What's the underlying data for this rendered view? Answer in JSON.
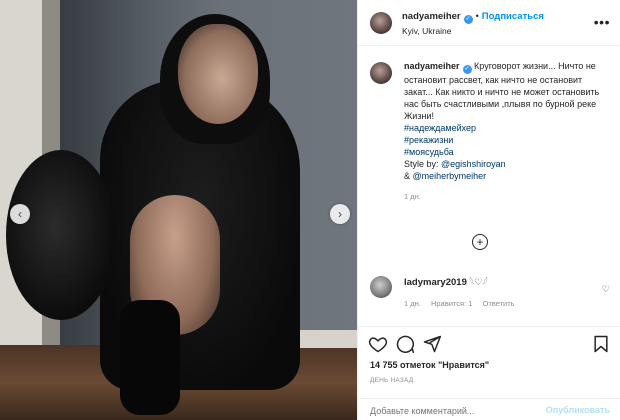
{
  "header": {
    "username": "nadyameiher",
    "separator": "•",
    "follow_label": "Подписаться",
    "location": "Kyiv, Ukraine",
    "more_label": "•••"
  },
  "caption": {
    "username": "nadyameiher",
    "text": "Круговорот жизни... Ничто не остановит рассвет, как ничто не остановит закат... Как никто и ничто не может остановить нас быть счастливыми ,плывя по бурной реке Жизни!",
    "hashtags": [
      "#надеждамейхер",
      "#рекажизни",
      "#моясудьба"
    ],
    "style_prefix": "Style by: ",
    "mention1": "@egishshiroyan",
    "amp": "& ",
    "mention2": "@meiherbymeiher",
    "time": "1 дн."
  },
  "add_comment_icon": "plus-circle-icon",
  "comment": {
    "username": "ladymary2019",
    "text": "𓆩♡𓆪",
    "time": "1 дн.",
    "likes": "Нравится: 1",
    "reply": "Ответить"
  },
  "likes_text": "14 755 отметок \"Нравится\"",
  "date_text": "ДЕНЬ НАЗАД",
  "input": {
    "placeholder": "Добавьте комментарий..."
  },
  "publish_label": "Опубликовать",
  "colors": {
    "link": "#00376b",
    "accent": "#0095f6",
    "muted": "#8e8e8e",
    "publish_disabled": "#b2dffc"
  }
}
